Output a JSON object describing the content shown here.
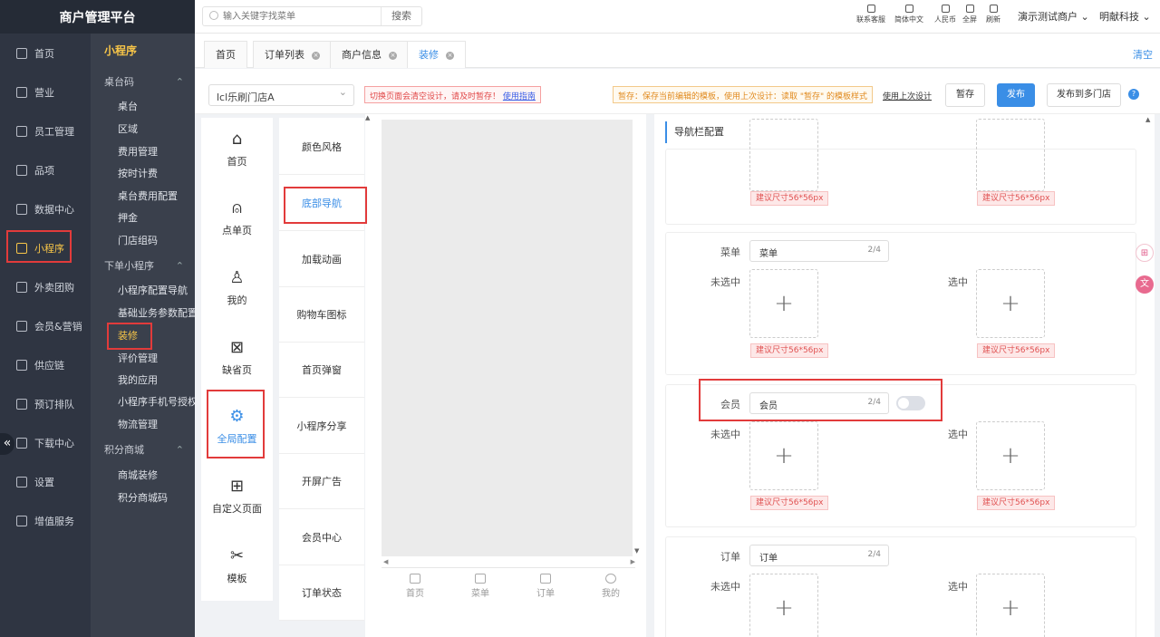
{
  "app": {
    "title": "商户管理平台"
  },
  "sidebar": {
    "items": [
      {
        "label": "首页"
      },
      {
        "label": "营业"
      },
      {
        "label": "员工管理"
      },
      {
        "label": "品项"
      },
      {
        "label": "数据中心"
      },
      {
        "label": "小程序",
        "active": true
      },
      {
        "label": "外卖团购"
      },
      {
        "label": "会员&营销"
      },
      {
        "label": "供应链"
      },
      {
        "label": "预订排队"
      },
      {
        "label": "下载中心"
      },
      {
        "label": "设置"
      },
      {
        "label": "增值服务"
      }
    ]
  },
  "submenu": {
    "title": "小程序",
    "groups": [
      {
        "label": "桌台码",
        "items": [
          "桌台",
          "区域",
          "费用管理",
          "按时计费",
          "桌台费用配置",
          "押金",
          "门店组码"
        ]
      },
      {
        "label": "下单小程序",
        "items": [
          "小程序配置导航",
          "基础业务参数配置",
          "装修",
          "评价管理",
          "我的应用",
          "小程序手机号授权",
          "物流管理"
        ]
      },
      {
        "label": "积分商城",
        "items": [
          "商城装修",
          "积分商城码"
        ]
      }
    ]
  },
  "topbar": {
    "search_placeholder": "输入关键字找菜单",
    "search_button": "搜索",
    "tools": [
      "联系客服",
      "简体中文",
      "人民币",
      "全屏",
      "刷新"
    ],
    "merchant": "演示测试商户",
    "company": "明献科技"
  },
  "tabs": {
    "items": [
      {
        "label": "首页",
        "closable": false
      },
      {
        "label": "订单列表",
        "closable": true
      },
      {
        "label": "商户信息",
        "closable": true
      },
      {
        "label": "装修",
        "closable": true,
        "active": true
      }
    ],
    "clear_label": "清空"
  },
  "toolbar": {
    "store": "lcl乐刷门店A",
    "tip_red": "切换页面会清空设计，请及时暂存！",
    "tip_red_link": "使用指南",
    "tip_orange": "暂存：保存当前编辑的模板，使用上次设计：读取 \"暂存\" 的模板样式",
    "use_last": "使用上次设计",
    "save_draft": "暂存",
    "publish": "发布",
    "publish_multi": "发布到多门店",
    "help": "?"
  },
  "left_nav": [
    {
      "label": "首页",
      "icon": "home-icon",
      "glyph": "⌂"
    },
    {
      "label": "点单页",
      "icon": "bell-icon",
      "glyph": "⍝"
    },
    {
      "label": "我的",
      "icon": "user-icon",
      "glyph": "♙"
    },
    {
      "label": "缺省页",
      "icon": "file-x-icon",
      "glyph": "⊠"
    },
    {
      "label": "全局配置",
      "icon": "settings-icon",
      "glyph": "⚙",
      "active": true
    },
    {
      "label": "自定义页面",
      "icon": "file-plus-icon",
      "glyph": "⊞"
    },
    {
      "label": "模板",
      "icon": "scissors-icon",
      "glyph": "✂"
    }
  ],
  "mid_nav": [
    {
      "label": "颜色风格"
    },
    {
      "label": "底部导航",
      "active": true
    },
    {
      "label": "加载动画"
    },
    {
      "label": "购物车图标"
    },
    {
      "label": "首页弹窗"
    },
    {
      "label": "小程序分享"
    },
    {
      "label": "开屏广告"
    },
    {
      "label": "会员中心"
    },
    {
      "label": "订单状态"
    }
  ],
  "preview": {
    "bottom_bar": [
      "首页",
      "菜单",
      "订单",
      "我的"
    ]
  },
  "config": {
    "header": "导航栏配置",
    "size_hint": "建议尺寸56*56px",
    "unselected_label": "未选中",
    "selected_label": "选中",
    "entries": [
      {
        "label": "菜单",
        "value": "菜单",
        "count": "2/4",
        "has_switch": false
      },
      {
        "label": "会员",
        "value": "会员",
        "count": "2/4",
        "has_switch": true,
        "switch_on": false
      },
      {
        "label": "订单",
        "value": "订单",
        "count": "2/4",
        "has_switch": false
      }
    ]
  },
  "colors": {
    "accent": "#3a8ee6",
    "brand_yellow": "#f7c548",
    "highlight_red": "#e23b3b"
  }
}
